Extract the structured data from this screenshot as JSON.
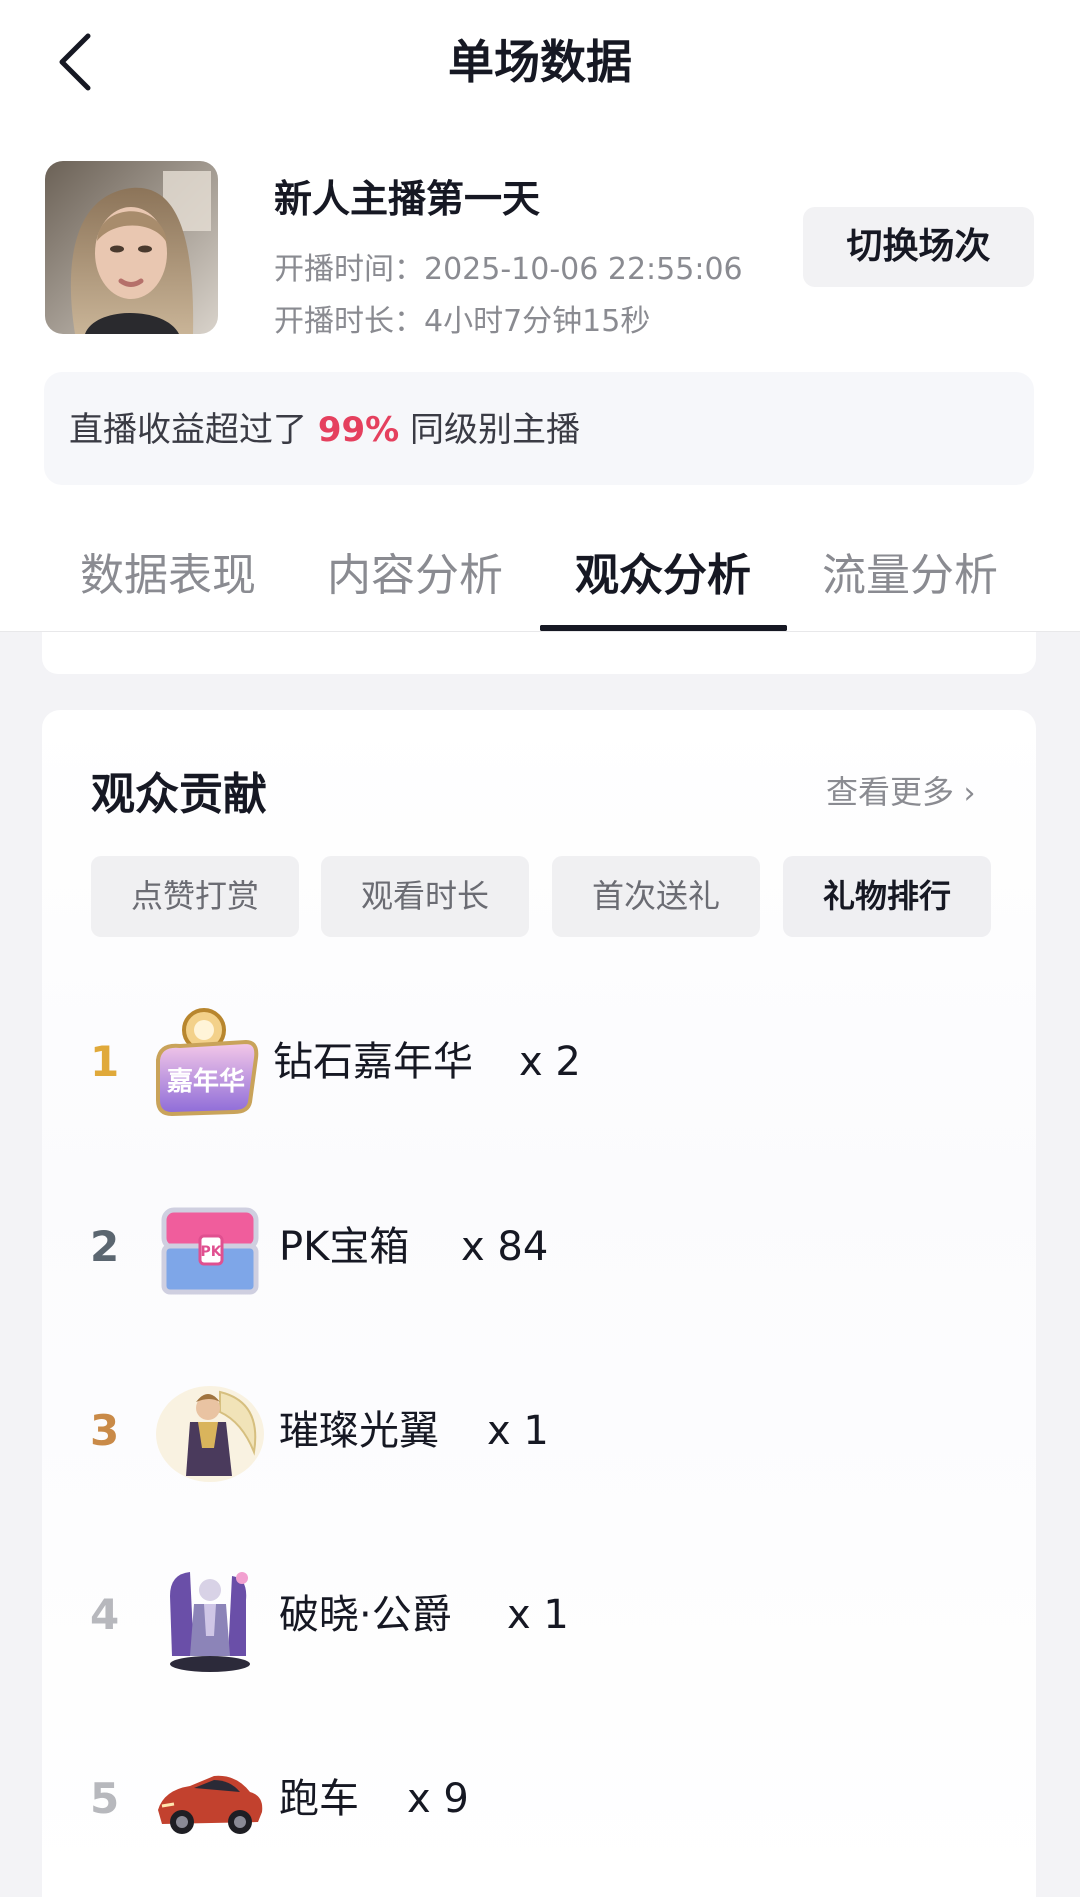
{
  "header": {
    "title": "单场数据",
    "back_icon": "chevron-left-icon"
  },
  "stream": {
    "name": "新人主播第一天",
    "start_time": "开播时间：2025-10-06 22:55:06",
    "duration": "开播时长：4小时7分钟15秒",
    "switch_label": "切换场次"
  },
  "banner": {
    "prefix": "直播收益超过了 ",
    "percent": "99%",
    "suffix": " 同级别主播"
  },
  "tabs": [
    {
      "label": "数据表现",
      "active": false
    },
    {
      "label": "内容分析",
      "active": false
    },
    {
      "label": "观众分析",
      "active": true
    },
    {
      "label": "流量分析",
      "active": false
    }
  ],
  "contribution": {
    "title": "观众贡献",
    "more_label": "查看更多",
    "chips": [
      {
        "label": "点赞打赏",
        "active": false
      },
      {
        "label": "观看时长",
        "active": false
      },
      {
        "label": "首次送礼",
        "active": false
      },
      {
        "label": "礼物排行",
        "active": true
      }
    ],
    "gifts": [
      {
        "rank": "1",
        "name": "钻石嘉年华",
        "count": "x 2",
        "rank_color": "#e0a93a",
        "icon": "diamond-carnival-gift-icon"
      },
      {
        "rank": "2",
        "name": "PK宝箱",
        "count": "x 84",
        "rank_color": "#5b6670",
        "icon": "pk-treasure-chest-gift-icon"
      },
      {
        "rank": "3",
        "name": "璀璨光翼",
        "count": "x 1",
        "rank_color": "#c98a48",
        "icon": "shining-wings-gift-icon"
      },
      {
        "rank": "4",
        "name": "破晓·公爵",
        "count": "x 1",
        "rank_color": "#b7b8bd",
        "icon": "dawn-duke-gift-icon"
      },
      {
        "rank": "5",
        "name": "跑车",
        "count": "x 9",
        "rank_color": "#b7b8bd",
        "icon": "sports-car-gift-icon"
      }
    ]
  }
}
